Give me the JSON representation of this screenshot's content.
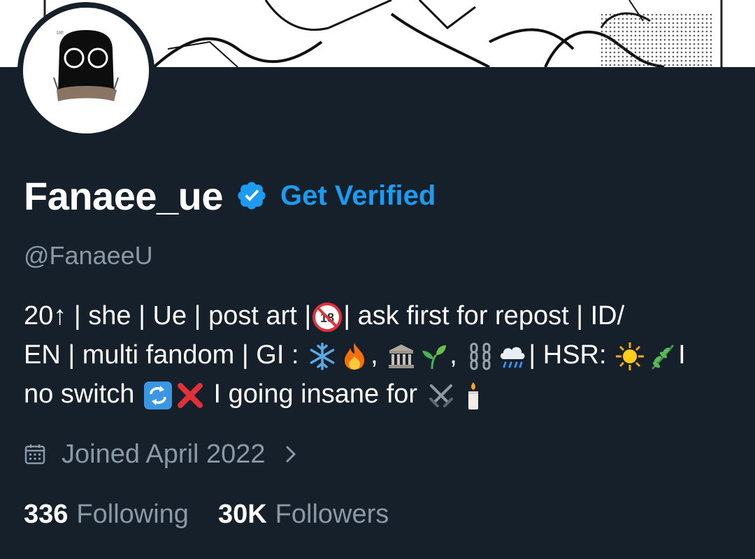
{
  "profile": {
    "display_name": "Fanaee_ue",
    "get_verified_label": "Get Verified",
    "handle": "@FanaeeU",
    "bio_lines": [
      [
        "20↑ | she | Ue | post art |",
        "no-18-icon",
        "| ask first for repost | ID/"
      ],
      [
        "EN | multi fandom | GI : ",
        "snowflake-icon",
        "fire-icon",
        ", ",
        "classical-building-icon",
        "seedling-icon",
        ", ",
        "chains-icon",
        "rain-cloud-icon",
        "| HSR: ",
        "sun-icon",
        "herb-icon",
        "I"
      ],
      [
        "no switch ",
        "switch-arrows-icon",
        "cross-mark-icon",
        " I going insane for ",
        "crossed-swords-icon",
        "candle-icon"
      ]
    ],
    "joined_text": "Joined April 2022",
    "following_count": "336",
    "following_label": "Following",
    "followers_count": "30K",
    "followers_label": "Followers"
  },
  "colors": {
    "background": "#15202b",
    "accent": "#1d9bf0",
    "secondary_text": "#8b98a5",
    "primary_text": "#ffffff"
  },
  "icons": [
    "verified-badge-icon",
    "calendar-icon",
    "chevron-right-icon",
    "avatar-image",
    "banner-image"
  ]
}
